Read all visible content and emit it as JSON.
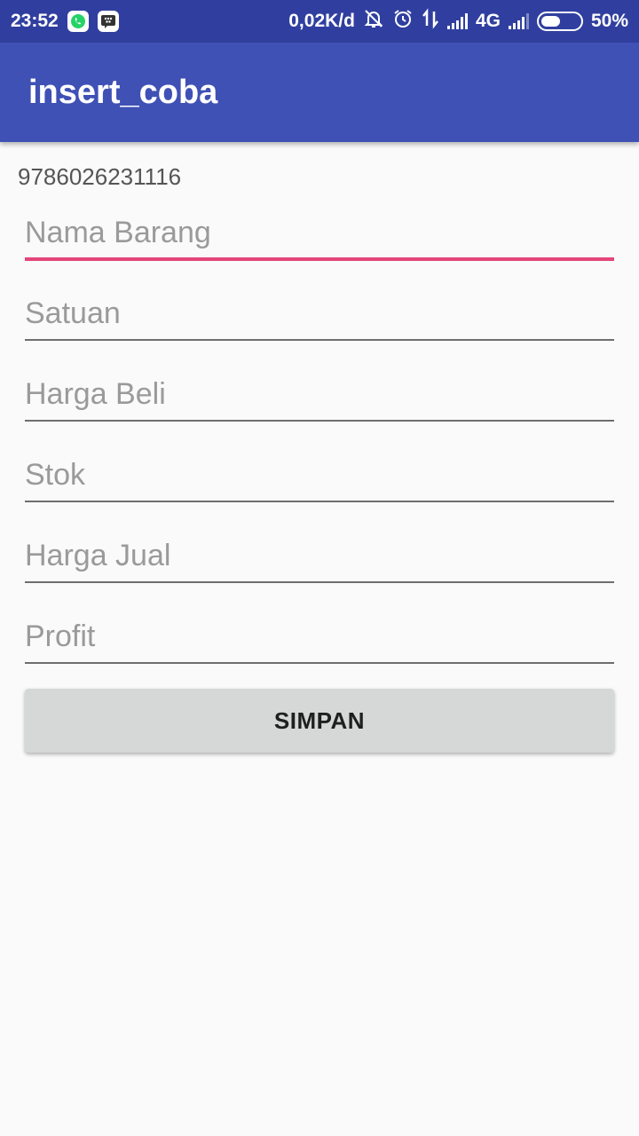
{
  "status_bar": {
    "time": "23:52",
    "net_speed": "0,02K/d",
    "network": "4G",
    "battery": "50%",
    "battery_level": 0.5,
    "left_icons": [
      "whatsapp-icon",
      "bbm-icon"
    ],
    "right_icons": [
      "notifications-off-icon",
      "alarm-icon",
      "data-transfer-icon",
      "signal-icon",
      "signal-icon",
      "battery-icon"
    ]
  },
  "toolbar": {
    "title": "insert_coba"
  },
  "form": {
    "barcode": "9786026231116",
    "fields": {
      "nama_barang": {
        "placeholder": "Nama Barang",
        "value": ""
      },
      "satuan": {
        "placeholder": "Satuan",
        "value": ""
      },
      "harga_beli": {
        "placeholder": "Harga Beli",
        "value": ""
      },
      "stok": {
        "placeholder": "Stok",
        "value": ""
      },
      "harga_jual": {
        "placeholder": "Harga Jual",
        "value": ""
      },
      "profit": {
        "placeholder": "Profit",
        "value": ""
      }
    },
    "submit_label": "SIMPAN"
  },
  "colors": {
    "status_bar": "#303f9f",
    "toolbar": "#3f51b5",
    "accent": "#e5457a",
    "background": "#fafafa"
  }
}
